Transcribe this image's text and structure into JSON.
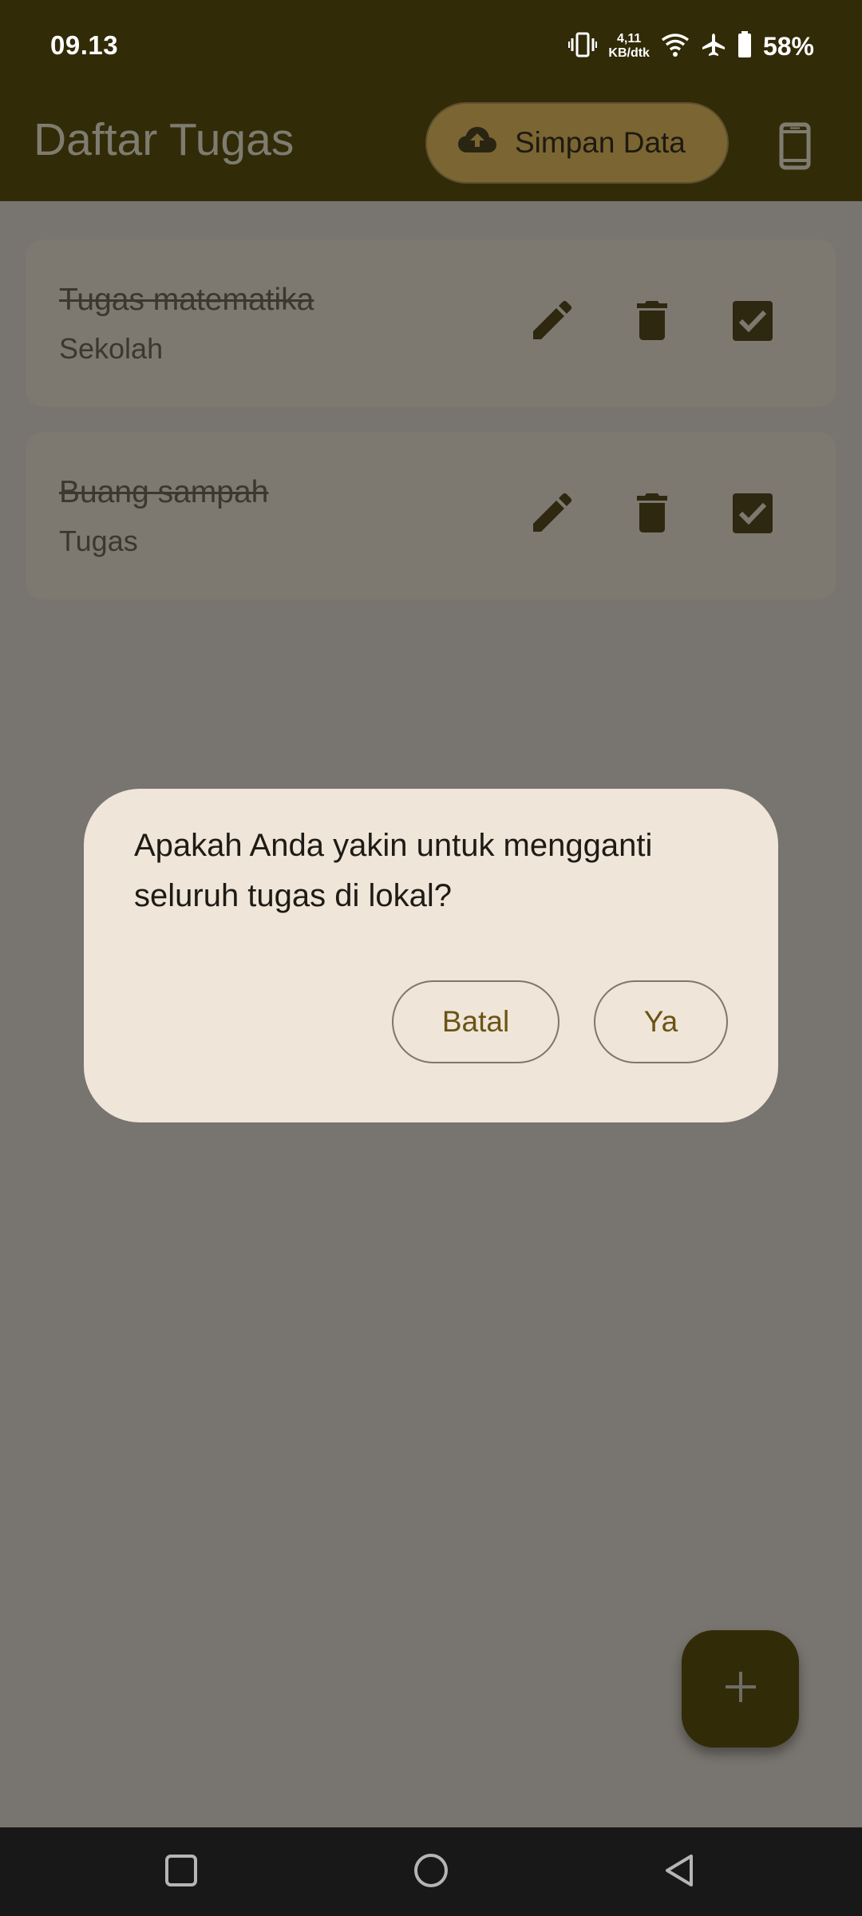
{
  "status_bar": {
    "time": "09.13",
    "net_speed_value": "4,11",
    "net_speed_unit": "KB/dtk",
    "battery": "58%",
    "icons": [
      "vibrate-icon",
      "wifi-icon",
      "airplane-mode-icon",
      "battery-icon"
    ]
  },
  "app_bar": {
    "title": "Daftar Tugas",
    "save_button_label": "Simpan Data",
    "save_icon": "cloud-upload-icon",
    "device_icon": "phone-icon"
  },
  "tasks": [
    {
      "title": "Tugas matematika",
      "category": "Sekolah",
      "completed": true
    },
    {
      "title": "Buang sampah",
      "category": "Tugas",
      "completed": true
    }
  ],
  "dialog": {
    "message": "Apakah Anda yakin untuk mengganti seluruh tugas di lokal?",
    "cancel_label": "Batal",
    "confirm_label": "Ya"
  },
  "fab": {
    "icon": "plus-icon"
  },
  "nav_bar": {
    "icons": [
      "recents-icon",
      "home-icon",
      "back-icon"
    ]
  },
  "colors": {
    "app_bar_bg": "#322b08",
    "scrim_bg": "#78746f",
    "dialog_bg": "#efe5d8",
    "accent_text": "#6a5415",
    "save_button_bg": "#7b6533"
  }
}
